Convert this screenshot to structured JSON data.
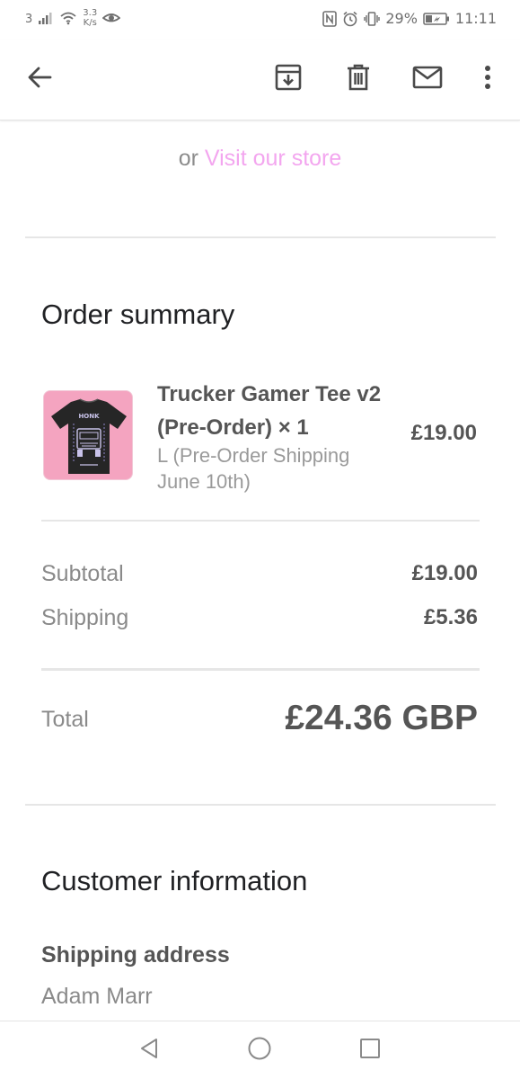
{
  "status_bar": {
    "sim": "3",
    "net_speed_value": "3.3",
    "net_speed_unit": "K/s",
    "battery": "29%",
    "time": "11:11"
  },
  "app_bar": {
    "icons": [
      "back-arrow-icon",
      "archive-icon",
      "delete-icon",
      "mail-icon",
      "more-vert-icon"
    ]
  },
  "store": {
    "prefix": "or",
    "link_text": "Visit our store",
    "link_color": "#f3a6ef"
  },
  "order_summary": {
    "title": "Order summary",
    "item": {
      "name": "Trucker Gamer Tee v2 (Pre-Order) × 1",
      "variant": "L (Pre-Order Shipping June 10th)",
      "price": "£19.00",
      "image_bg": "#f4a4c0"
    },
    "subtotal_label": "Subtotal",
    "subtotal_value": "£19.00",
    "shipping_label": "Shipping",
    "shipping_value": "£5.36",
    "total_label": "Total",
    "total_value": "£24.36 GBP"
  },
  "customer_information": {
    "title": "Customer information",
    "shipping_address_label": "Shipping address",
    "name": "Adam Marr"
  },
  "nav_bar": {
    "icons": [
      "nav-back-icon",
      "nav-home-icon",
      "nav-recents-icon"
    ]
  }
}
